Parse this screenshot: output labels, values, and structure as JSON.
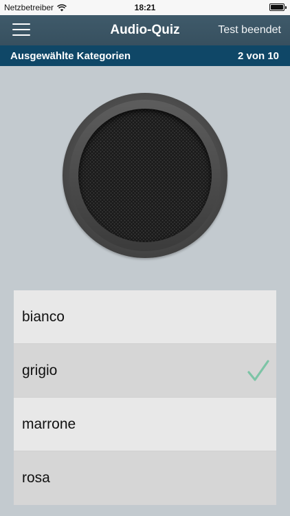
{
  "status_bar": {
    "carrier": "Netzbetreiber",
    "time": "18:21",
    "icons": [
      "wifi-icon",
      "battery-icon"
    ]
  },
  "nav": {
    "title": "Audio-Quiz",
    "right_action": "Test beendet",
    "menu_icon": "hamburger-menu-icon"
  },
  "category_bar": {
    "label": "Ausgewählte Kategorien",
    "progress": "2 von 10"
  },
  "speaker": {
    "icon": "speaker-icon"
  },
  "answers": [
    {
      "label": "bianco",
      "selected": false
    },
    {
      "label": "grigio",
      "selected": true
    },
    {
      "label": "marrone",
      "selected": false
    },
    {
      "label": "rosa",
      "selected": false
    }
  ],
  "colors": {
    "nav_background": "#3f5a6a",
    "category_background": "#0f4767",
    "page_background": "#c3cacf",
    "check_color": "#7dc4a6"
  }
}
